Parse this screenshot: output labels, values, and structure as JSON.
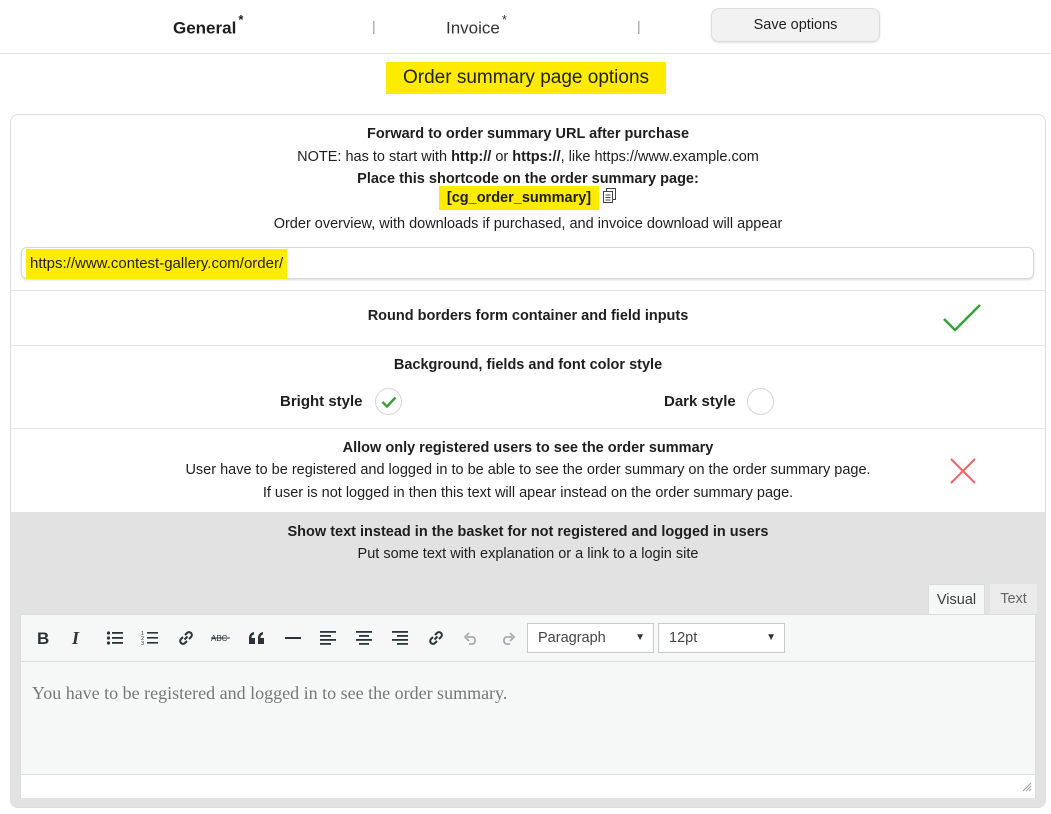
{
  "tabs": {
    "general": "General",
    "invoice": "Invoice",
    "asterisk": "*",
    "separator": "|",
    "save": "Save options"
  },
  "title": "Order summary page options",
  "forward": {
    "heading": "Forward to order summary URL after purchase",
    "note_label": "NOTE:",
    "note_1": " has to start with ",
    "note_http": "http://",
    "note_or": " or ",
    "note_https": "https://",
    "note_2": ", like https://www.example.com",
    "shortcode_heading": "Place this shortcode on the order summary page:",
    "shortcode": "[cg_order_summary]",
    "overview": "Order overview, with downloads if purchased, and invoice download will appear",
    "url_value": "https://www.contest-gallery.com/order/"
  },
  "round_borders": {
    "label": "Round borders form container and field inputs",
    "checked": true
  },
  "style": {
    "heading": "Background, fields and font color style",
    "bright": "Bright style",
    "dark": "Dark style",
    "selected": "bright"
  },
  "registered": {
    "heading": "Allow only registered users to see the order summary",
    "line1": "User have to be registered and logged in to be able to see the order summary on the order summary page.",
    "line2": "If user is not logged in then this text will apear instead on the order summary page.",
    "checked": false
  },
  "basket_text": {
    "heading": "Show text instead in the basket for not registered and logged in users",
    "sub": "Put some text with explanation or a link to a login site"
  },
  "editor": {
    "tab_visual": "Visual",
    "tab_text": "Text",
    "format": "Paragraph",
    "size": "12pt",
    "content": "You have to be registered and logged in to see the order summary.",
    "toolbar_icons": [
      "bold-icon",
      "italic-icon",
      "bullet-list-icon",
      "numbered-list-icon",
      "link-icon",
      "strikethrough-icon",
      "blockquote-icon",
      "horizontal-rule-icon",
      "align-left-icon",
      "align-center-icon",
      "align-right-icon",
      "unlink-icon",
      "undo-icon",
      "redo-icon"
    ]
  },
  "colors": {
    "highlight": "#ffeb00",
    "check_green": "#3a9d3a",
    "cross_red": "#e8666a"
  }
}
